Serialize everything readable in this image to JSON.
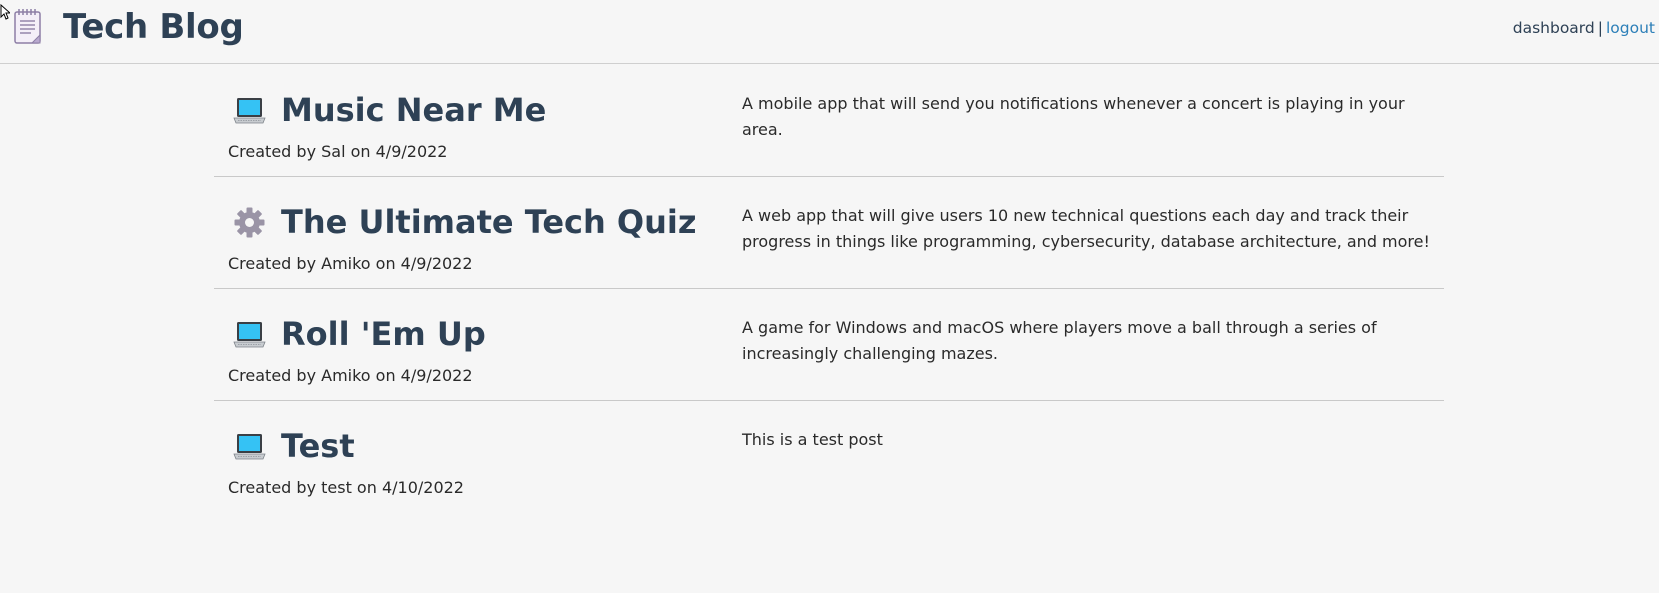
{
  "header": {
    "title": "Tech Blog",
    "logo_icon": "notepad-icon",
    "nav": {
      "dashboard_label": "dashboard",
      "separator": "|",
      "logout_label": "logout"
    }
  },
  "colors": {
    "title": "#2e4155",
    "link": "#2c7fb8",
    "background": "#f6f6f6",
    "divider": "#c9c9c9"
  },
  "posts": [
    {
      "icon": "laptop-icon",
      "title": "Music Near Me",
      "meta": "Created by Sal on 4/9/2022",
      "description": "A mobile app that will send you notifications whenever a concert is playing in your area."
    },
    {
      "icon": "gear-icon",
      "title": "The Ultimate Tech Quiz",
      "meta": "Created by Amiko on 4/9/2022",
      "description": "A web app that will give users 10 new technical questions each day and track their progress in things like programming, cybersecurity, database architecture, and more!"
    },
    {
      "icon": "laptop-icon",
      "title": "Roll 'Em Up",
      "meta": "Created by Amiko on 4/9/2022",
      "description": "A game for Windows and macOS where players move a ball through a series of increasingly challenging mazes."
    },
    {
      "icon": "laptop-icon",
      "title": "Test",
      "meta": "Created by test on 4/10/2022",
      "description": "This is a test post"
    }
  ]
}
